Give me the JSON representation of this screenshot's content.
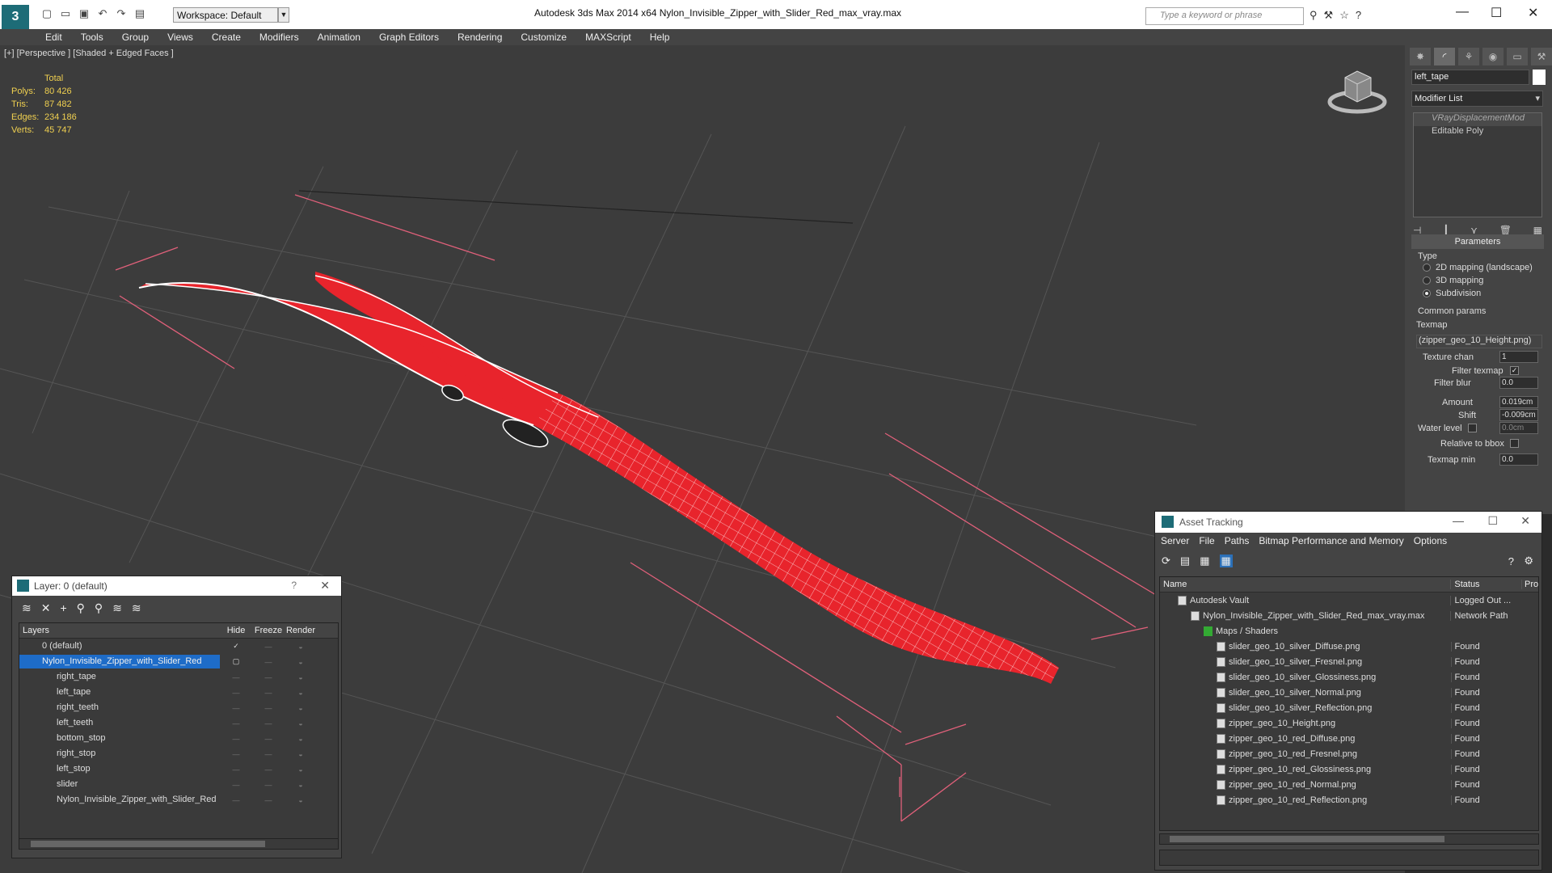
{
  "app": {
    "title": "Autodesk 3ds Max  2014 x64      Nylon_Invisible_Zipper_with_Slider_Red_max_vray.max",
    "workspace": "Workspace: Default",
    "search_placeholder": "Type a keyword or phrase"
  },
  "menu": [
    "Edit",
    "Tools",
    "Group",
    "Views",
    "Create",
    "Modifiers",
    "Animation",
    "Graph Editors",
    "Rendering",
    "Customize",
    "MAXScript",
    "Help"
  ],
  "viewport": {
    "label": "[+] [Perspective ] [Shaded + Edged Faces ]",
    "stats": {
      "header": "Total",
      "rows": [
        {
          "k": "Polys:",
          "v": "80 426"
        },
        {
          "k": "Tris:",
          "v": "87 482"
        },
        {
          "k": "Edges:",
          "v": "234 186"
        },
        {
          "k": "Verts:",
          "v": "45 747"
        }
      ]
    },
    "colors": {
      "mesh": "#e8242c",
      "wire": "#ffffff",
      "bbox": "#e0607a",
      "grid": "#555555"
    }
  },
  "command_panel": {
    "object_name": "left_tape",
    "modifier_list": "Modifier List",
    "stack": [
      "VRayDisplacementMod",
      "Editable Poly"
    ],
    "rollout": "Parameters",
    "type_label": "Type",
    "types": [
      "2D mapping (landscape)",
      "3D mapping",
      "Subdivision"
    ],
    "common": "Common params",
    "texmap_label": "Texmap",
    "texmap": "(zipper_geo_10_Height.png)",
    "texture_chan_label": "Texture chan",
    "texture_chan": "1",
    "filter_texmap": "Filter texmap",
    "filter_blur_label": "Filter blur",
    "filter_blur": "0.0",
    "amount_label": "Amount",
    "amount": "0.019cm",
    "shift_label": "Shift",
    "shift": "-0.009cm",
    "water_label": "Water level",
    "water": "0.0cm",
    "relative": "Relative to bbox",
    "texmap_min_label": "Texmap min",
    "texmap_min": "0.0"
  },
  "layer_panel": {
    "title": "Layer: 0 (default)",
    "help": "?",
    "columns": [
      "Layers",
      "Hide",
      "Freeze",
      "Render"
    ],
    "rows": [
      {
        "name": "0 (default)",
        "level": 0
      },
      {
        "name": "Nylon_Invisible_Zipper_with_Slider_Red",
        "level": 0,
        "selected": true
      },
      {
        "name": "right_tape",
        "level": 1
      },
      {
        "name": "left_tape",
        "level": 1
      },
      {
        "name": "right_teeth",
        "level": 1
      },
      {
        "name": "left_teeth",
        "level": 1
      },
      {
        "name": "bottom_stop",
        "level": 1
      },
      {
        "name": "right_stop",
        "level": 1
      },
      {
        "name": "left_stop",
        "level": 1
      },
      {
        "name": "slider",
        "level": 1
      },
      {
        "name": "Nylon_Invisible_Zipper_with_Slider_Red",
        "level": 1
      }
    ]
  },
  "asset_panel": {
    "title": "Asset Tracking",
    "menu": [
      "Server",
      "File",
      "Paths",
      "Bitmap Performance and Memory",
      "Options"
    ],
    "columns": [
      "Name",
      "Status",
      "Pro"
    ],
    "rows": [
      {
        "name": "Autodesk Vault",
        "status": "Logged Out ...",
        "level": 1
      },
      {
        "name": "Nylon_Invisible_Zipper_with_Slider_Red_max_vray.max",
        "status": "Network Path",
        "level": 2
      },
      {
        "name": "Maps / Shaders",
        "status": "",
        "level": 3
      },
      {
        "name": "slider_geo_10_silver_Diffuse.png",
        "status": "Found",
        "level": 4
      },
      {
        "name": "slider_geo_10_silver_Fresnel.png",
        "status": "Found",
        "level": 4
      },
      {
        "name": "slider_geo_10_silver_Glossiness.png",
        "status": "Found",
        "level": 4
      },
      {
        "name": "slider_geo_10_silver_Normal.png",
        "status": "Found",
        "level": 4
      },
      {
        "name": "slider_geo_10_silver_Reflection.png",
        "status": "Found",
        "level": 4
      },
      {
        "name": "zipper_geo_10_Height.png",
        "status": "Found",
        "level": 4
      },
      {
        "name": "zipper_geo_10_red_Diffuse.png",
        "status": "Found",
        "level": 4
      },
      {
        "name": "zipper_geo_10_red_Fresnel.png",
        "status": "Found",
        "level": 4
      },
      {
        "name": "zipper_geo_10_red_Glossiness.png",
        "status": "Found",
        "level": 4
      },
      {
        "name": "zipper_geo_10_red_Normal.png",
        "status": "Found",
        "level": 4
      },
      {
        "name": "zipper_geo_10_red_Reflection.png",
        "status": "Found",
        "level": 4
      }
    ]
  }
}
